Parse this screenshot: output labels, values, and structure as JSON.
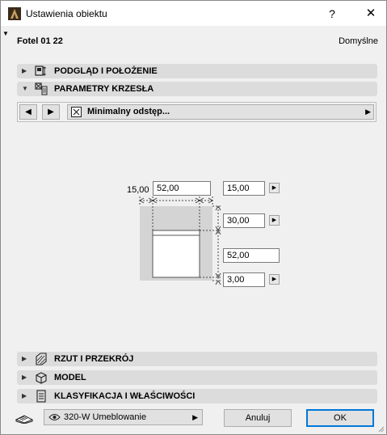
{
  "window": {
    "title": "Ustawienia obiektu",
    "help_label": "?",
    "close_label": "✕"
  },
  "object": {
    "name": "Fotel 01 22",
    "default_label": "Domyślne"
  },
  "panels": {
    "preview": "PODGLĄD I POŁOŻENIE",
    "chair": "PARAMETRY KRZESŁA",
    "plan": "RZUT I PRZEKRÓJ",
    "model": "MODEL",
    "classification": "KLASYFIKACJA I WŁAŚCIWOŚCI"
  },
  "nav": {
    "prev": "◀",
    "next": "▶",
    "selected": "Minimalny odstęp...",
    "arrow": "▶"
  },
  "dimensions": {
    "left_gap_label": "15,00",
    "width": "52,00",
    "right_gap": "15,00",
    "top_gap": "30,00",
    "depth": "52,00",
    "bottom_gap": "3,00"
  },
  "footer": {
    "layer": "320-W Umeblowanie",
    "cancel": "Anuluj",
    "ok": "OK"
  },
  "icons": [
    "app-icon",
    "help-icon",
    "close-icon",
    "expand-arrow-icon",
    "preview-icon",
    "chair-params-icon",
    "prev-arrow-icon",
    "next-arrow-icon",
    "param-icon",
    "section-icon",
    "model-icon",
    "classification-icon",
    "layer-eye-icon",
    "furniture-icon"
  ]
}
